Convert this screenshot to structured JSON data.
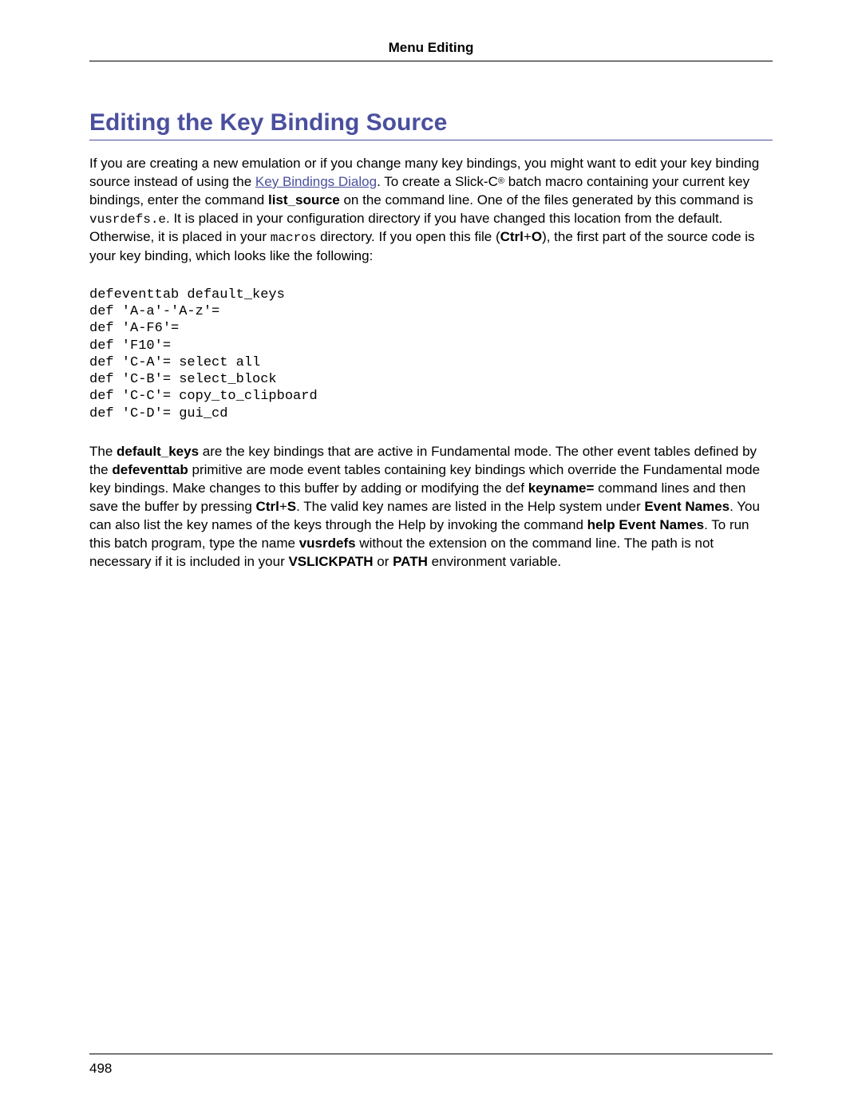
{
  "header": {
    "title": "Menu Editing"
  },
  "heading": "Editing the Key Binding Source",
  "p1": {
    "t1": "If you are creating a new emulation or if you change many key bindings, you might want to edit your key binding source instead of using the ",
    "link": "Key Bindings Dialog",
    "t2": ". To create a Slick-C",
    "reg": "®",
    "t3": " batch macro containing your current key bindings, enter the command ",
    "cmd": "list_source",
    "t4": " on the command line. One of the files generated by this command is ",
    "file": "vusrdefs.e",
    "t5": ". It is placed in your configuration directory if you have changed this location from the default. Otherwise, it is placed in your ",
    "dir": "macros",
    "t6": " directory. If you open this file (",
    "key1": "Ctrl",
    "plus": "+",
    "key2": "O",
    "t7": "), the first part of the source code is your key binding, which looks like the following:"
  },
  "code": "defeventtab default_keys\ndef 'A-a'-'A-z'=\ndef 'A-F6'=\ndef 'F10'=\ndef 'C-A'= select all\ndef 'C-B'= select_block\ndef 'C-C'= copy_to_clipboard\ndef 'C-D'= gui_cd",
  "p2": {
    "t1": "The ",
    "b1": "default_keys",
    "t2": " are the key bindings that are active in Fundamental mode. The other event tables defined by the ",
    "b2": "defeventtab",
    "t3": " primitive are mode event tables containing key bindings which override the Fundamental mode key bindings. Make changes to this buffer by adding or modifying the def ",
    "b3": "keyname=",
    "t4": " command lines and then save the buffer by pressing ",
    "k1": "Ctrl",
    "plus": "+",
    "k2": "S",
    "t5": ". The valid key names are listed in the Help system under ",
    "b4": "Event Names",
    "t6": ". You can also list the key names of the keys through the Help by invoking the command ",
    "b5": "help Event Names",
    "t7": ". To run this batch program, type the name ",
    "b6": "vusrdefs",
    "t8": " without the extension on the command line. The path is not necessary if it is included in your ",
    "b7": "VSLICKPATH",
    "t9": " or ",
    "b8": "PATH",
    "t10": " environment variable."
  },
  "footer": {
    "page": "498"
  }
}
